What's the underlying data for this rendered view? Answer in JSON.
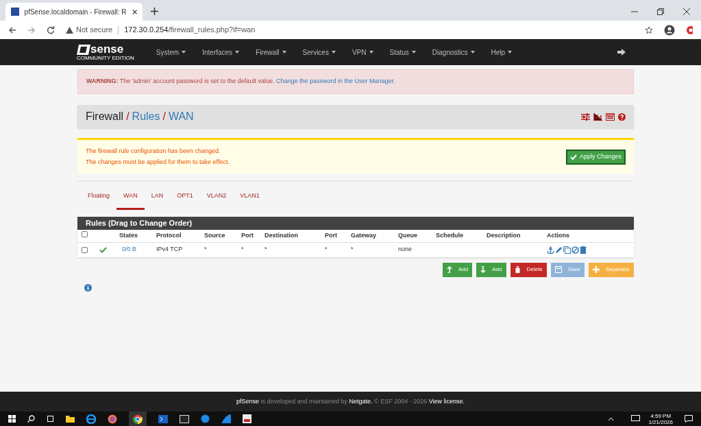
{
  "browser": {
    "tab_title": "pfSense.localdomain - Firewall: R",
    "url_warning": "Not secure",
    "url_host": "172.30.0.254",
    "url_path": "/firewall_rules.php?if=wan"
  },
  "navbar": {
    "logo": "sense",
    "logo_sub": "COMMUNITY EDITION",
    "menus": [
      "System",
      "Interfaces",
      "Firewall",
      "Services",
      "VPN",
      "Status",
      "Diagnostics",
      "Help"
    ]
  },
  "warning": {
    "label": "WARNING:",
    "text": "The 'admin' account password is set to the default value.",
    "link": "Change the password in the User Manager."
  },
  "breadcrumb": [
    "Firewall",
    "Rules",
    "WAN"
  ],
  "breadcrumb_separator": "/",
  "notice": {
    "lines": [
      "The firewall rule configuration has been changed.",
      "The changes must be applied for them to take effect."
    ],
    "button": "Apply Changes"
  },
  "tabs": [
    {
      "label": "Floating",
      "selected": false
    },
    {
      "label": "WAN",
      "selected": true
    },
    {
      "label": "LAN",
      "selected": false
    },
    {
      "label": "OPT1",
      "selected": false
    },
    {
      "label": "VLAN2",
      "selected": false
    },
    {
      "label": "VLAN1",
      "selected": false
    }
  ],
  "table": {
    "title": "Rules (Drag to Change Order)",
    "select_all_checked": false,
    "columns": [
      "States",
      "Protocol",
      "Source",
      "Port",
      "Destination",
      "Port",
      "Gateway",
      "Queue",
      "Schedule",
      "Description",
      "Actions"
    ],
    "rows": [
      {
        "checked": false,
        "enabled": true,
        "cells": [
          "0/0 B",
          "IPv4 TCP",
          "*",
          "*",
          "*",
          "*",
          "*",
          "none",
          "",
          ""
        ]
      }
    ]
  },
  "buttons": [
    {
      "kind": "add-top",
      "label": "Add"
    },
    {
      "kind": "add-bottom",
      "label": "Add"
    },
    {
      "kind": "delete",
      "label": "Delete"
    },
    {
      "kind": "save",
      "label": "Save"
    },
    {
      "kind": "separator",
      "label": "Separator"
    }
  ],
  "footer": {
    "brand": "pfSense",
    "text": " is developed and maintained by ",
    "company": "Netgate.",
    "copyright": " © ESF 2004 - 2026 ",
    "license": "View license."
  },
  "taskbar": {
    "time": "4:59 PM",
    "date": "1/21/2026"
  }
}
